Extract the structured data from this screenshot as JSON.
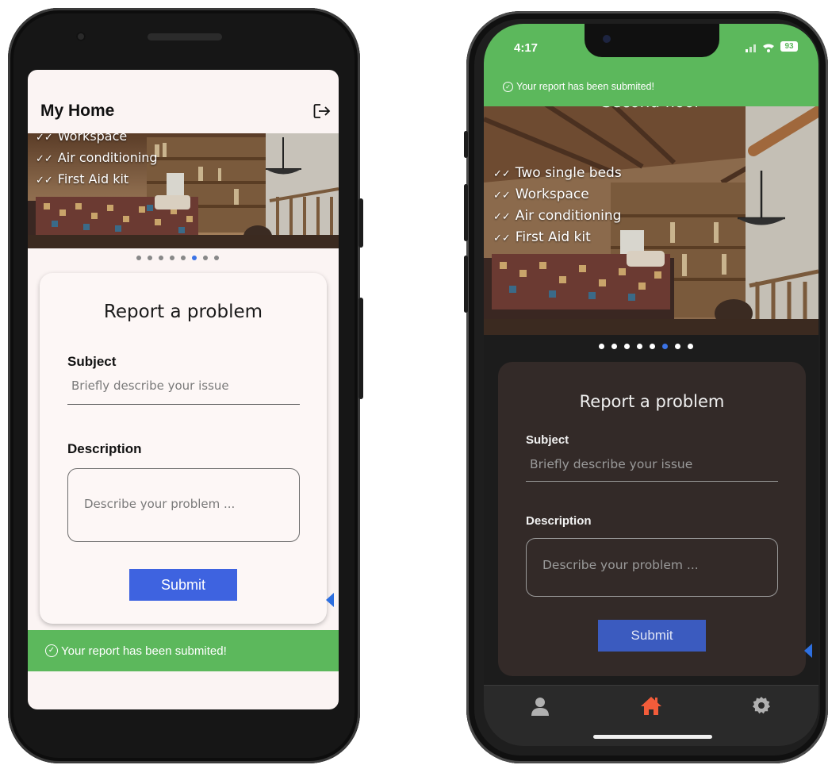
{
  "android": {
    "app_title": "My Home",
    "logout_icon": "logout-icon",
    "features": [
      "Workspace",
      "Air conditioning",
      "First Aid kit"
    ],
    "carousel": {
      "count": 8,
      "active_index": 5
    },
    "report_card": {
      "title": "Report a problem",
      "subject_label": "Subject",
      "subject_placeholder": "Briefly describe your issue",
      "description_label": "Description",
      "description_placeholder": "Describe your problem ...",
      "submit_label": "Submit"
    },
    "snackbar": "Your report has been submited!"
  },
  "ios": {
    "status_time": "4:17",
    "battery": "93",
    "snackbar": "Your report has been submited!",
    "photo_caption": "Second floor",
    "features": [
      "Two single beds",
      "Workspace",
      "Air conditioning",
      "First Aid kit"
    ],
    "carousel": {
      "count": 8,
      "active_index": 5
    },
    "report_card": {
      "title": "Report a problem",
      "subject_label": "Subject",
      "subject_placeholder": "Briefly describe your issue",
      "description_label": "Description",
      "description_placeholder": "Describe your problem ...",
      "submit_label": "Submit"
    },
    "tabs": [
      {
        "icon": "person-icon",
        "color": "#b0b0b0"
      },
      {
        "icon": "home-icon",
        "color": "#f25c3a"
      },
      {
        "icon": "settings-icon",
        "color": "#b0b0b0"
      }
    ]
  },
  "colors": {
    "success": "#5cb85c",
    "accent": "#3e63e0",
    "active_dot": "#3b73e6"
  }
}
